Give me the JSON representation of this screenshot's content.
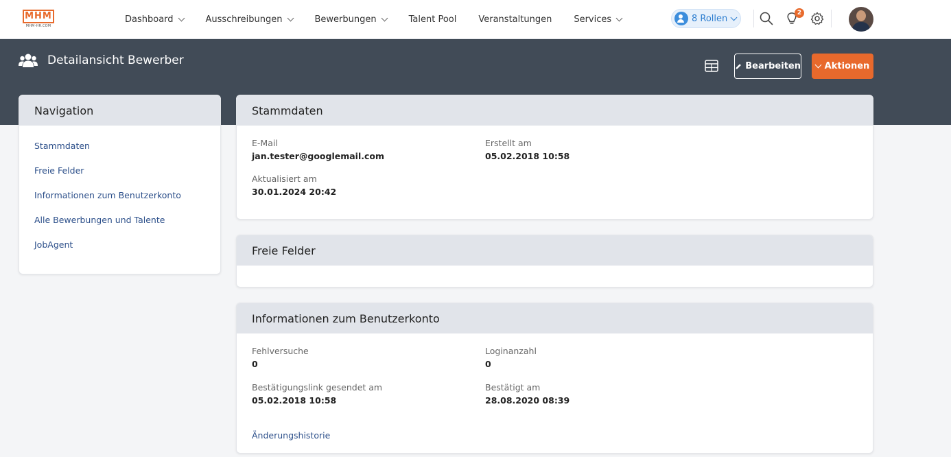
{
  "logo": {
    "text": "MHM",
    "sub": "MHM-HR.COM"
  },
  "menu": [
    {
      "label": "Dashboard",
      "dropdown": true
    },
    {
      "label": "Ausschreibungen",
      "dropdown": true
    },
    {
      "label": "Bewerbungen",
      "dropdown": true
    },
    {
      "label": "Talent Pool",
      "dropdown": false
    },
    {
      "label": "Veranstaltungen",
      "dropdown": false
    },
    {
      "label": "Services",
      "dropdown": true
    }
  ],
  "topbar": {
    "roles_label": "8 Rollen",
    "notification_count": "2"
  },
  "header": {
    "title": "Detailansicht Bewerber",
    "edit_label": "Bearbeiten",
    "actions_label": "Aktionen"
  },
  "navigation": {
    "title": "Navigation",
    "items": [
      "Stammdaten",
      "Freie Felder",
      "Informationen zum Benutzerkonto",
      "Alle Bewerbungen und Talente",
      "JobAgent"
    ]
  },
  "stammdaten": {
    "title": "Stammdaten",
    "email_label": "E-Mail",
    "email_value": "jan.tester@googlemail.com",
    "created_label": "Erstellt am",
    "created_value": "05.02.2018 10:58",
    "updated_label": "Aktualisiert am",
    "updated_value": "30.01.2024 20:42"
  },
  "freie_felder": {
    "title": "Freie Felder"
  },
  "benutzerkonto": {
    "title": "Informationen zum Benutzerkonto",
    "failed_label": "Fehlversuche",
    "failed_value": "0",
    "logins_label": "Loginanzahl",
    "logins_value": "0",
    "link_sent_label": "Bestätigungslink gesendet am",
    "link_sent_value": "05.02.2018 10:58",
    "confirmed_label": "Bestätigt am",
    "confirmed_value": "28.08.2020 08:39",
    "history_label": "Änderungshistorie"
  },
  "colors": {
    "accent": "#e8692c",
    "header_bg": "#414b57",
    "link": "#2c4f8a",
    "card_head": "#e1e4ea"
  }
}
